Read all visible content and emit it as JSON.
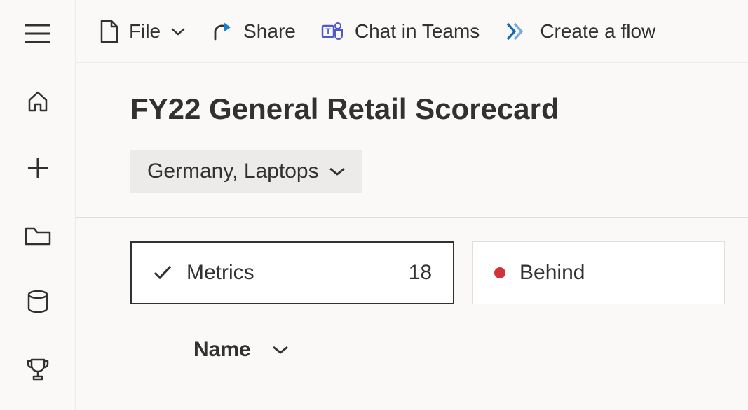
{
  "topbar": {
    "file_label": "File",
    "share_label": "Share",
    "chat_label": "Chat in Teams",
    "flow_label": "Create a flow"
  },
  "header": {
    "title": "FY22 General Retail Scorecard",
    "filter_label": "Germany, Laptops"
  },
  "cards": {
    "metrics_label": "Metrics",
    "metrics_count": "18",
    "behind_label": "Behind"
  },
  "table": {
    "col_name": "Name"
  }
}
